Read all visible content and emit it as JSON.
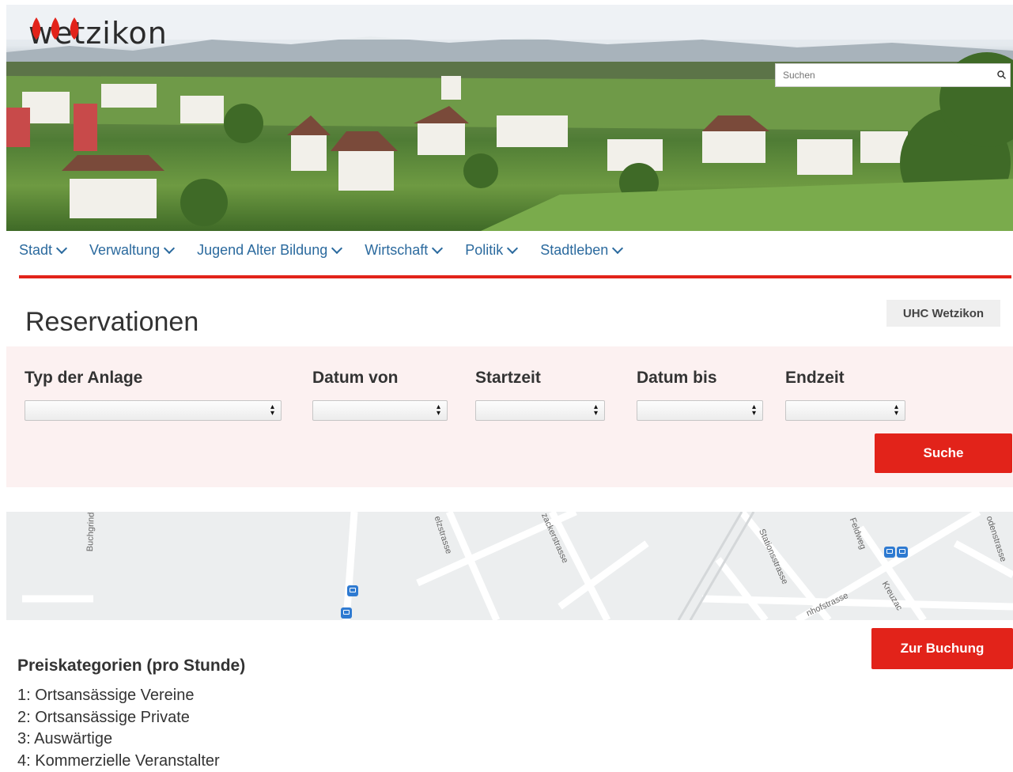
{
  "header": {
    "logo_text": "wetzikon",
    "search_placeholder": "Suchen"
  },
  "nav": {
    "items": [
      {
        "label": "Stadt"
      },
      {
        "label": "Verwaltung"
      },
      {
        "label": "Jugend Alter Bildung"
      },
      {
        "label": "Wirtschaft"
      },
      {
        "label": "Politik"
      },
      {
        "label": "Stadtleben"
      }
    ]
  },
  "page": {
    "title": "Reservationen",
    "club_badge": "UHC Wetzikon"
  },
  "filters": {
    "type_label": "Typ der Anlage",
    "date_from_label": "Datum von",
    "start_time_label": "Startzeit",
    "date_to_label": "Datum bis",
    "end_time_label": "Endzeit",
    "search_button": "Suche"
  },
  "map": {
    "streets": [
      "Buchgrindelstras",
      "elzstrasse",
      "zackerstrasse",
      "Stationsstrasse",
      "Feldweg",
      "nhofstrasse",
      "Kreuzac",
      "odenstrasse"
    ]
  },
  "booking": {
    "button": "Zur Buchung"
  },
  "prices": {
    "heading": "Preiskategorien (pro Stunde)",
    "items": [
      "1: Ortsansässige Vereine",
      "2: Ortsansässige Private",
      "3: Auswärtige",
      "4: Kommerzielle Veranstalter"
    ]
  },
  "colors": {
    "accent_red": "#e2231a",
    "nav_blue": "#2b6a9e",
    "panel_bg": "#fcf1f1"
  }
}
